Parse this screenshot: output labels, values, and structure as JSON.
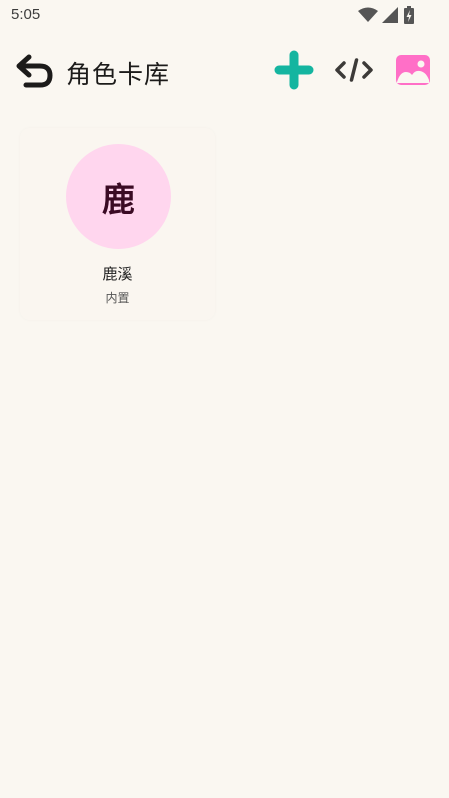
{
  "status_bar": {
    "time": "5:05",
    "icons": [
      "wifi-icon",
      "signal-icon",
      "battery-charging-icon"
    ]
  },
  "app_bar": {
    "title": "角色卡库",
    "back_icon": "back-arrow-icon",
    "actions": [
      {
        "name": "add",
        "icon": "plus-icon",
        "color": "#14b5a0"
      },
      {
        "name": "code",
        "icon": "code-icon",
        "color": "#3c3a38"
      },
      {
        "name": "image",
        "icon": "image-icon",
        "color": "#ff6fc7"
      }
    ]
  },
  "cards": [
    {
      "avatar_text": "鹿",
      "name": "鹿溪",
      "badge": "内置",
      "avatar_color": "#ffd6ee"
    }
  ]
}
